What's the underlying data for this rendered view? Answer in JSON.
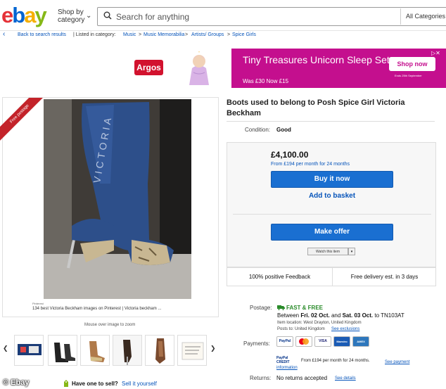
{
  "header": {
    "logo_letters": [
      "e",
      "b",
      "a",
      "y"
    ],
    "logo_colors": [
      "#e53238",
      "#0064d2",
      "#f5af02",
      "#86b817"
    ],
    "shop_by_line1": "Shop by",
    "shop_by_line2": "category",
    "search_placeholder": "Search for anything",
    "all_categories": "All Categories"
  },
  "breadcrumb": {
    "back": "Back to search results",
    "listed_in": "| Listed in category:",
    "items": [
      "Music",
      "Music Memorabilia",
      "Artists/ Groups",
      "Spice Girls"
    ],
    "separator": ">"
  },
  "ad": {
    "brand": "Argos",
    "title": "Tiny Treasures Unicorn Sleep Set",
    "subtitle": "Was £30 Now £15",
    "button": "Shop now",
    "end_date": "Ends 25th September",
    "brand_color": "#c40f8e"
  },
  "gallery": {
    "badge": "Free postage",
    "pinterest_small": "Pinterest",
    "caption": "134 best Victoria Beckham images on Pinterest | Victoria beckham ...",
    "boot_text": "VICTORIA",
    "mouse_over": "Mouse over image to zoom",
    "thumbnail_count": 6
  },
  "listing": {
    "title": "Boots used to belong to Posh Spice Girl Victoria Beckham",
    "condition_label": "Condition:",
    "condition_value": "Good",
    "price": "£4,100.00",
    "monthly": "From £194 per month for 24 months",
    "buy_now": "Buy it now",
    "add_to_basket": "Add to basket",
    "make_offer": "Make offer",
    "watch": "Watch this item",
    "feedback": "100% positive Feedback",
    "delivery": "Free delivery est. in 3 days"
  },
  "postage": {
    "label": "Postage:",
    "fast_free": "FAST & FREE",
    "between": "Between",
    "date1": "Fri. 02 Oct.",
    "and": "and",
    "date2": "Sat. 03 Oct.",
    "to": "to TN103AT",
    "item_location": "Item location:  West Drayton, United Kingdom",
    "posts_to": "Posts to:  United Kingdom",
    "see_exclusions": "See exclusions"
  },
  "payments": {
    "label": "Payments:",
    "cards": [
      "PayPal",
      "",
      "VISA",
      "Maestro",
      "AMEX"
    ],
    "credit_brand": "PayPal CREDIT",
    "credit_text": "From £194 per month for 24 months.",
    "see_payment": "See payment",
    "information": "information"
  },
  "returns": {
    "label": "Returns:",
    "text": "No returns accepted",
    "see_details": "See details"
  },
  "footer": {
    "have_one": "Have one to sell?",
    "sell_it": "Sell it yourself",
    "watermark": "© Ebay"
  }
}
